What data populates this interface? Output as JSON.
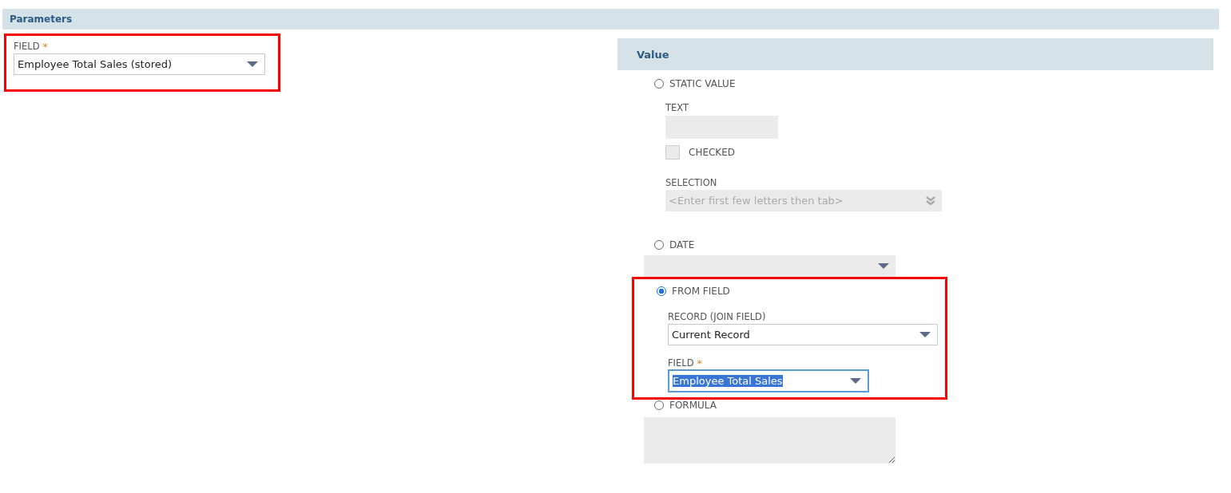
{
  "section": {
    "title": "Parameters"
  },
  "field": {
    "label": "FIELD",
    "required": "*",
    "value": "Employee Total Sales (stored)",
    "highlighted": true
  },
  "value_panel": {
    "title": "Value",
    "options": [
      {
        "kind": "static",
        "label": "STATIC VALUE",
        "selected": false,
        "text_label": "TEXT",
        "checkbox": {
          "label": "CHECKED",
          "checked": false
        },
        "selection_label": "SELECTION",
        "selection_placeholder": "<Enter first few letters then tab>"
      },
      {
        "kind": "date",
        "label": "DATE",
        "selected": false
      },
      {
        "kind": "from_field",
        "label": "FROM FIELD",
        "selected": true,
        "highlighted": true,
        "record_label": "RECORD (JOIN FIELD)",
        "record_value": "Current Record",
        "field_label": "FIELD",
        "field_required": "*",
        "field_value": "Employee Total Sales"
      },
      {
        "kind": "formula",
        "label": "FORMULA",
        "selected": false
      }
    ]
  }
}
